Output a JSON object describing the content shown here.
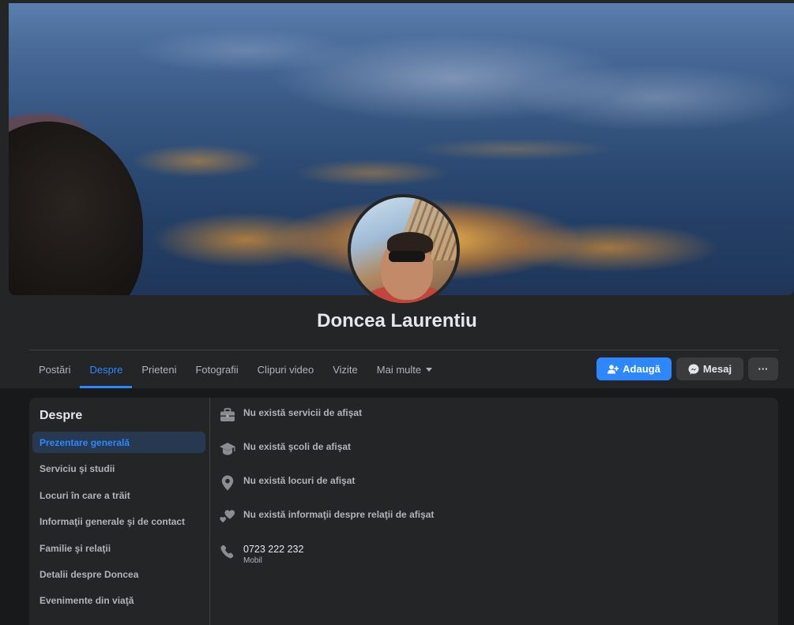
{
  "profile": {
    "name": "Doncea Laurentiu"
  },
  "tabs": [
    {
      "label": "Postări"
    },
    {
      "label": "Despre"
    },
    {
      "label": "Prieteni"
    },
    {
      "label": "Fotografii"
    },
    {
      "label": "Clipuri video"
    },
    {
      "label": "Vizite"
    },
    {
      "label": "Mai multe"
    }
  ],
  "actions": {
    "add_label": "Adaugă",
    "message_label": "Mesaj",
    "more_label": "···"
  },
  "about": {
    "title": "Despre",
    "sidebar": [
      {
        "label": "Prezentare generală"
      },
      {
        "label": "Serviciu şi studii"
      },
      {
        "label": "Locuri în care a trăit"
      },
      {
        "label": "Informaţii generale şi de contact"
      },
      {
        "label": "Familie şi relaţii"
      },
      {
        "label": "Detalii despre Doncea"
      },
      {
        "label": "Evenimente din viaţă"
      }
    ],
    "rows": [
      {
        "icon": "briefcase-icon",
        "text": "Nu există servicii de afişat"
      },
      {
        "icon": "graduation-cap-icon",
        "text": "Nu există şcoli de afişat"
      },
      {
        "icon": "location-pin-icon",
        "text": "Nu există locuri de afişat"
      },
      {
        "icon": "hearts-icon",
        "text": "Nu există informaţii despre relaţii de afişat"
      },
      {
        "icon": "phone-icon",
        "text": "0723 222 232",
        "sub": "Mobil"
      }
    ]
  },
  "colors": {
    "accent": "#2d88ff",
    "background": "#18191a",
    "card": "#242526",
    "active_side_bg": "#263951"
  }
}
